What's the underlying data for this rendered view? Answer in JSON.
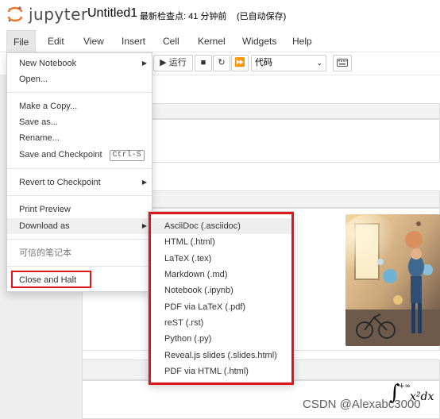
{
  "header": {
    "logo_text": "jupyter",
    "notebook_title": "Untitled1",
    "checkpoint": "最新检查点: 41 分钟前",
    "autosave": "(已自动保存)"
  },
  "menubar": [
    "File",
    "Edit",
    "View",
    "Insert",
    "Cell",
    "Kernel",
    "Widgets",
    "Help"
  ],
  "toolbar": {
    "run_label": "运行",
    "cell_type": "代码"
  },
  "file_menu": {
    "new_notebook": "New Notebook",
    "open": "Open...",
    "make_copy": "Make a Copy...",
    "save_as": "Save as...",
    "rename": "Rename...",
    "save_checkpoint": "Save and Checkpoint",
    "save_checkpoint_shortcut": "Ctrl-S",
    "revert": "Revert to Checkpoint",
    "print_preview": "Print Preview",
    "download_as": "Download as",
    "trusted": "可信的笔记本",
    "close_halt": "Close and Halt"
  },
  "download_submenu": [
    "AsciiDoc (.asciidoc)",
    "HTML (.html)",
    "LaTeX (.tex)",
    "Markdown (.md)",
    "Notebook (.ipynb)",
    "PDF via LaTeX (.pdf)",
    "reST (.rst)",
    "Python (.py)",
    "Reveal.js slides (.slides.html)",
    "PDF via HTML (.html)"
  ],
  "math": {
    "integral": "∫",
    "upper_limit": "+∞",
    "expression": "x²dx"
  },
  "watermark": "CSDN @Alexabc3000",
  "colors": {
    "highlight_red": "#e0141b",
    "jupyter_orange": "#f37626"
  }
}
